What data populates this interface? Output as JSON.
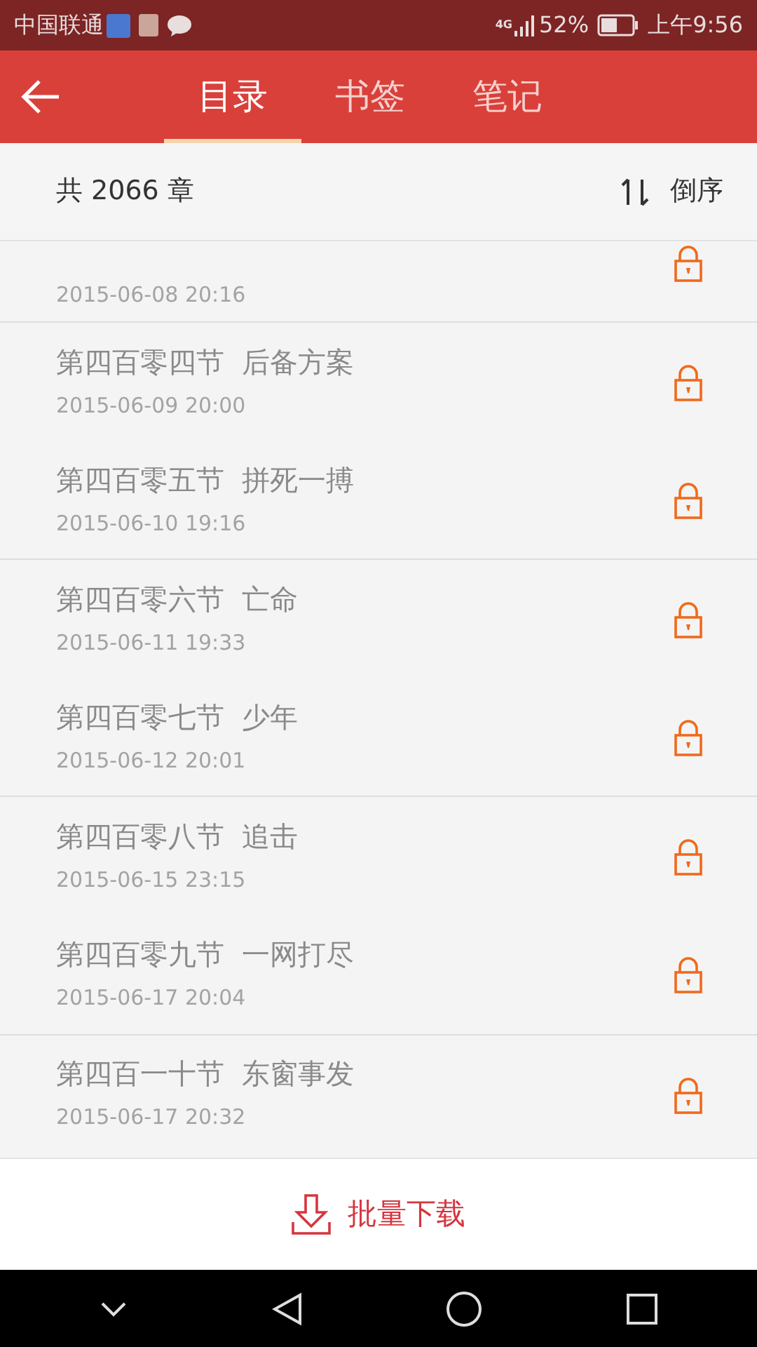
{
  "status_bar": {
    "carrier": "中国联通",
    "network": "4G",
    "battery": "52%",
    "time": "上午9:56"
  },
  "header": {
    "tabs": [
      {
        "label": "目录",
        "selected": true
      },
      {
        "label": "书签",
        "selected": false
      },
      {
        "label": "笔记",
        "selected": false
      }
    ]
  },
  "summary": {
    "count": "共 2066 章",
    "sort_label": "倒序"
  },
  "chapters": [
    {
      "date": "2015-06-08 20:16",
      "locked": true
    },
    {
      "title": "第四百零四节  后备方案",
      "date": "2015-06-09 20:00",
      "locked": true
    },
    {
      "title": "第四百零五节  拼死一搏",
      "date": "2015-06-10 19:16",
      "locked": true
    },
    {
      "title": "第四百零六节  亡命",
      "date": "2015-06-11 19:33",
      "locked": true
    },
    {
      "title": "第四百零七节  少年",
      "date": "2015-06-12 20:01",
      "locked": true
    },
    {
      "title": "第四百零八节  追击",
      "date": "2015-06-15 23:15",
      "locked": true
    },
    {
      "title": "第四百零九节  一网打尽",
      "date": "2015-06-17 20:04",
      "locked": true
    },
    {
      "title": "第四百一十节  东窗事发",
      "date": "2015-06-17 20:32",
      "locked": true
    }
  ],
  "download_button": "批量下载"
}
